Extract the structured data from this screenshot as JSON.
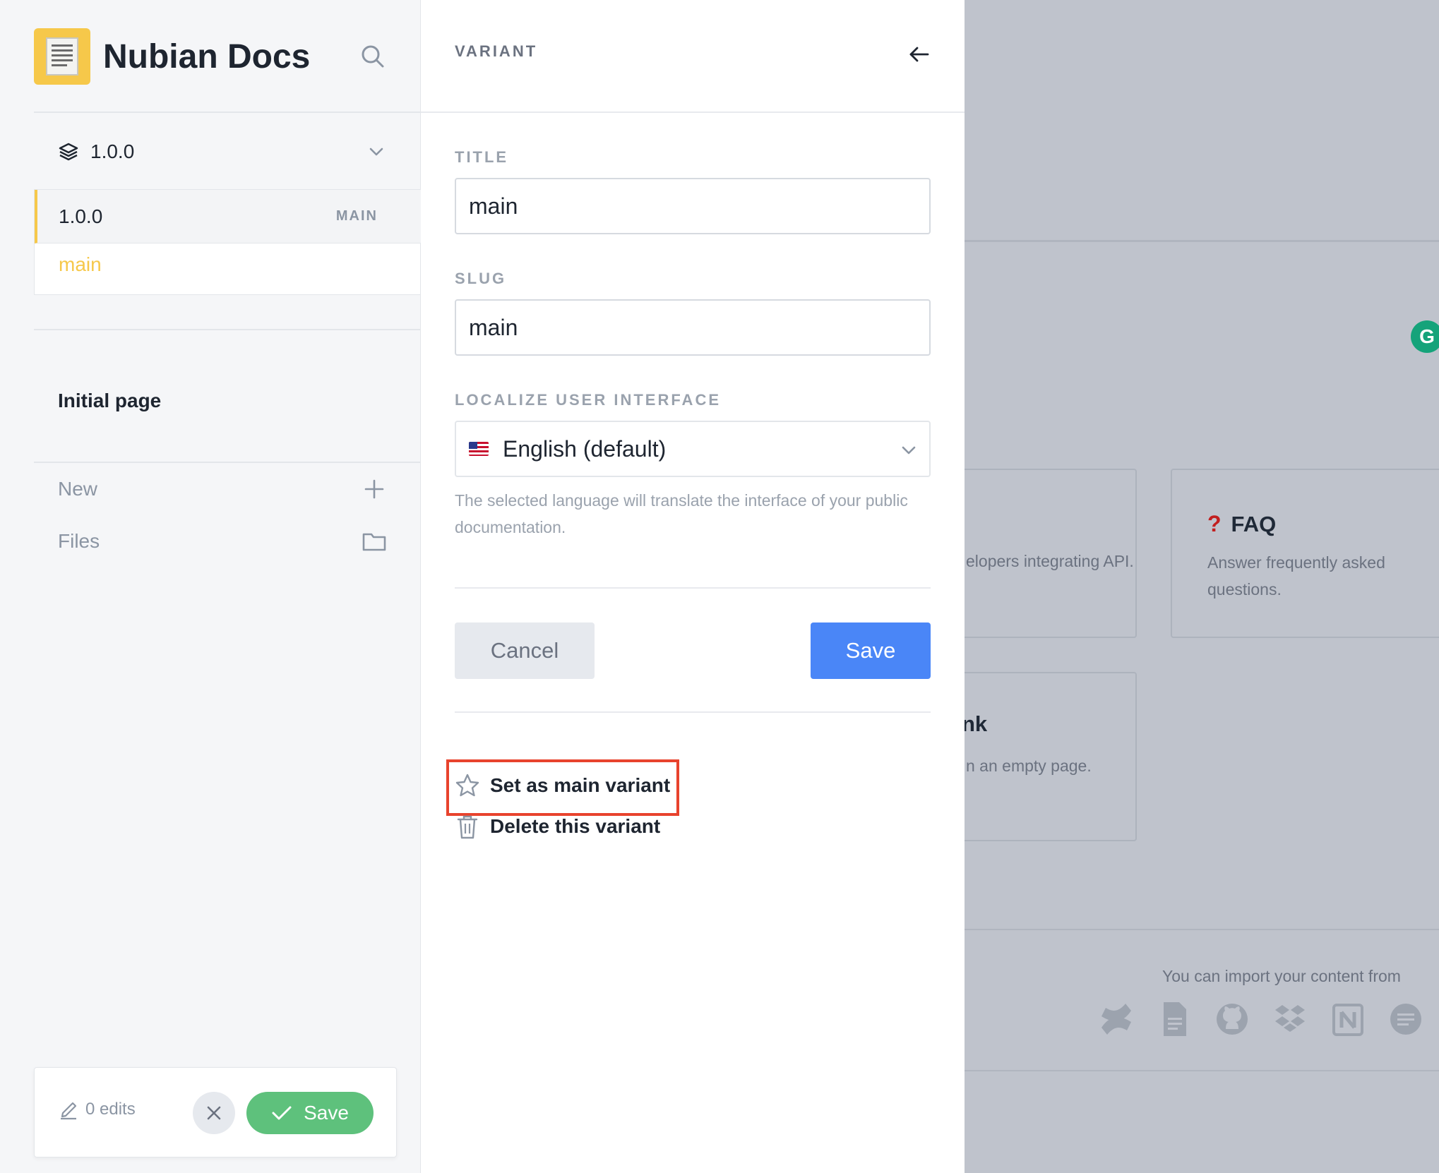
{
  "brand": {
    "name": "Nubian Docs"
  },
  "version_selector": {
    "current": "1.0.0"
  },
  "versions": [
    {
      "name": "1.0.0",
      "tag": "MAIN",
      "variants": [
        "main"
      ]
    }
  ],
  "sidebar": {
    "initial_page": "Initial page",
    "new_label": "New",
    "files_label": "Files"
  },
  "edits_bar": {
    "count_label": "0 edits",
    "save_label": "Save"
  },
  "panel": {
    "heading": "VARIANT",
    "title_label": "TITLE",
    "title_value": "main",
    "slug_label": "SLUG",
    "slug_value": "main",
    "localize_label": "LOCALIZE USER INTERFACE",
    "language_value": "English (default)",
    "help_text": "The selected language will translate the interface of your public documentation.",
    "cancel_label": "Cancel",
    "save_label": "Save",
    "set_main_label": "Set as main variant",
    "delete_label": "Delete this variant"
  },
  "background": {
    "card_api_desc": "elopers integrating API.",
    "faq_title": "FAQ",
    "faq_desc": "Answer frequently asked questions.",
    "blank_title": "nk",
    "blank_desc": "n an empty page.",
    "import_text": "You can import your content from",
    "import_icons": [
      "confluence-icon",
      "google-docs-icon",
      "github-icon",
      "dropbox-icon",
      "notion-icon",
      "quip-icon"
    ]
  },
  "colors": {
    "accent": "#f6c84a",
    "primary": "#4a86f7",
    "success": "#5ec17c",
    "highlight": "#e8432d"
  }
}
